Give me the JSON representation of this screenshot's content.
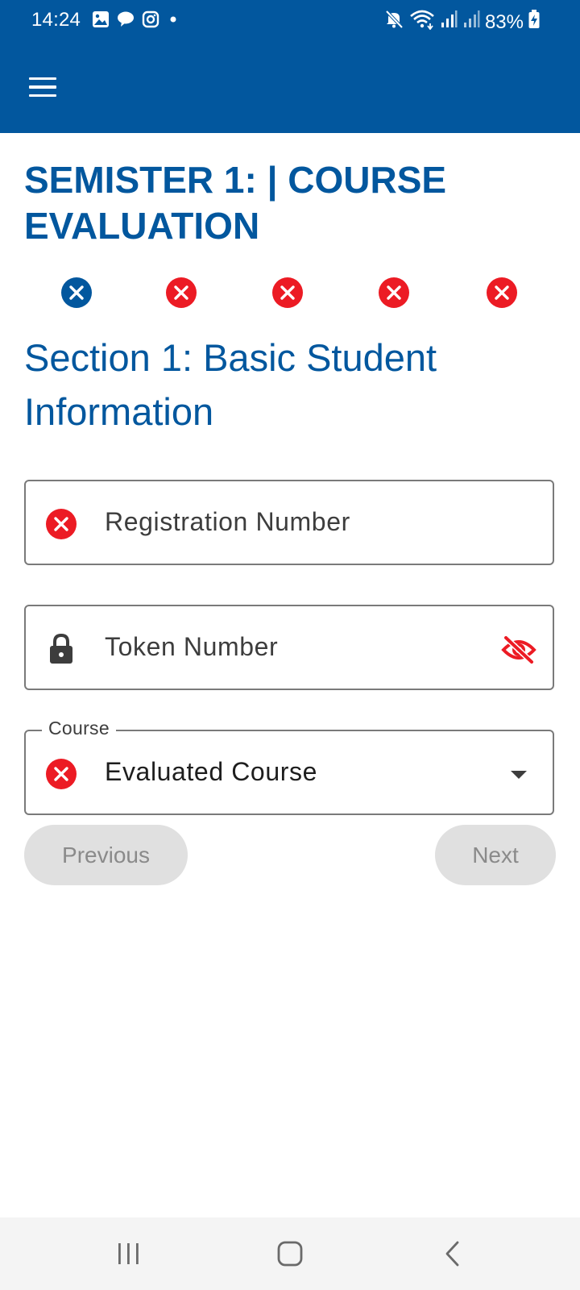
{
  "status_bar": {
    "time": "14:24",
    "battery": "83%",
    "notification_icons": [
      "gallery-icon",
      "chat-bubble-icon",
      "instagram-icon",
      "dot-icon"
    ],
    "system_icons": [
      "mute-icon",
      "wifi-icon",
      "signal-icon",
      "signal-icon",
      "battery-charging-icon"
    ]
  },
  "app_bar": {
    "menu_icon": "hamburger-menu-icon",
    "color": "#02579e"
  },
  "page": {
    "title": "SEMISTER 1: | COURSE EVALUATION",
    "section_title": "Section 1: Basic Student Information"
  },
  "stepper": {
    "steps": [
      {
        "state": "current",
        "icon": "close-circle-icon",
        "color": "#02579e"
      },
      {
        "state": "error",
        "icon": "close-circle-icon",
        "color": "#ec1b24"
      },
      {
        "state": "error",
        "icon": "close-circle-icon",
        "color": "#ec1b24"
      },
      {
        "state": "error",
        "icon": "close-circle-icon",
        "color": "#ec1b24"
      },
      {
        "state": "error",
        "icon": "close-circle-icon",
        "color": "#ec1b24"
      }
    ]
  },
  "form": {
    "registration": {
      "placeholder": "Registration Number",
      "icon": "error-circle-icon"
    },
    "token": {
      "placeholder": "Token Number",
      "icon": "lock-icon",
      "toggle_icon": "eye-off-icon"
    },
    "course": {
      "label": "Course",
      "value": "Evaluated Course",
      "icon": "error-circle-icon",
      "dropdown_icon": "chevron-down-icon"
    }
  },
  "buttons": {
    "previous": "Previous",
    "next": "Next"
  },
  "nav_bar": {
    "buttons": [
      "recent-apps-icon",
      "home-icon",
      "back-icon"
    ]
  },
  "colors": {
    "primary": "#02579e",
    "error": "#ec1b24",
    "disabled_button": "#e0e0e0",
    "disabled_text": "#8a8a8a"
  }
}
